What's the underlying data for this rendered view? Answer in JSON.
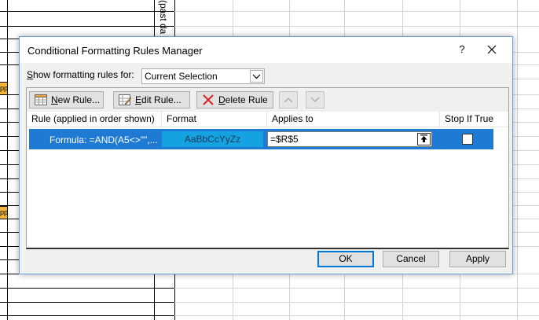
{
  "sheet": {
    "vertical_header": "(past da",
    "highlight_cells": [
      "pp",
      "pp"
    ]
  },
  "dialog": {
    "title": "Conditional Formatting Rules Manager",
    "help_glyph": "?",
    "show_rules_label_prefix": "",
    "show_rules_label_hotkey": "S",
    "show_rules_label_rest": "how formatting rules for:",
    "show_rules_value": "Current Selection"
  },
  "toolbar": {
    "new_rule_hotkey": "N",
    "new_rule_rest": "ew Rule...",
    "edit_rule_hotkey": "E",
    "edit_rule_rest": "dit Rule...",
    "delete_rule_hotkey": "D",
    "delete_rule_rest": "elete Rule"
  },
  "list": {
    "columns": [
      "Rule (applied in order shown)",
      "Format",
      "Applies to",
      "Stop If True"
    ],
    "rows": [
      {
        "rule": "Formula: =AND(A5<>\"\",...",
        "format_preview": "AaBbCcYyZz",
        "applies_to": "=$R$5",
        "stop_if_true": false
      }
    ]
  },
  "buttons": {
    "ok": "OK",
    "cancel": "Cancel",
    "apply": "Apply"
  },
  "colors": {
    "selection": "#1e7ad3",
    "format_preview_fill": "#14a3e0",
    "dialog_border": "#6f9fd6",
    "highlight_cell": "#f5b83d"
  }
}
